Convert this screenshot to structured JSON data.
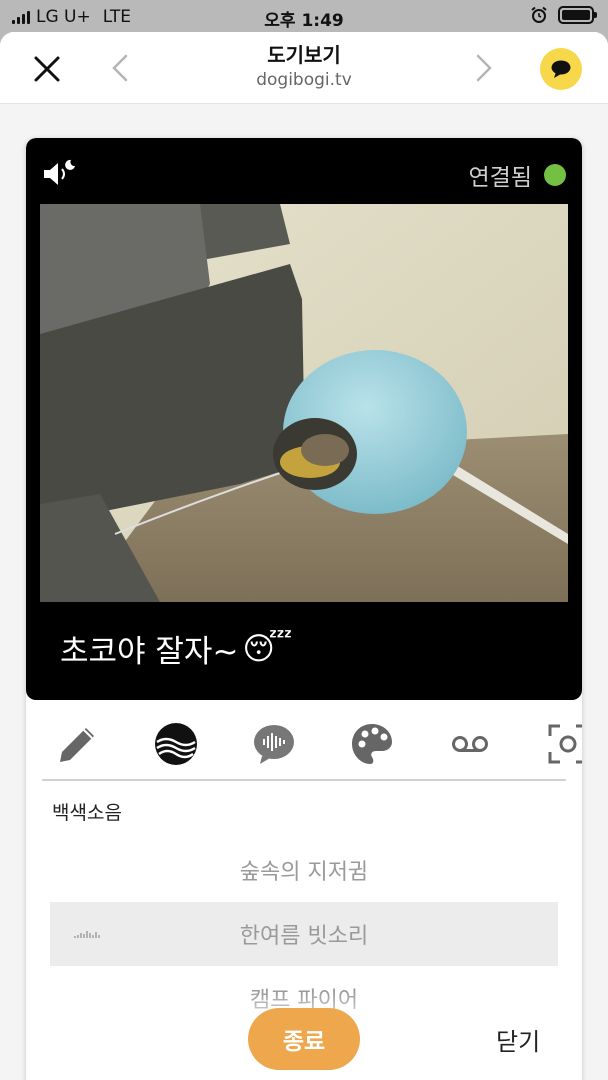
{
  "status_bar": {
    "carrier": "LG U+",
    "network": "LTE",
    "time": "오후 1:49"
  },
  "nav": {
    "title": "도기보기",
    "url": "dogibogi.tv",
    "icons": {
      "close": "close-icon",
      "prev": "chevron-left-icon",
      "next": "chevron-right-icon",
      "chat": "chat-bubble-icon"
    },
    "chat_color": "#f7d84b"
  },
  "player": {
    "status": "연결됨",
    "status_color": "#74c043",
    "caption": "초코야 잘자~",
    "caption_emoji": "😴"
  },
  "tools": [
    {
      "name": "pencil-icon"
    },
    {
      "name": "wave-icon"
    },
    {
      "name": "voice-message-icon"
    },
    {
      "name": "palette-icon"
    },
    {
      "name": "voicemail-icon"
    },
    {
      "name": "camera-capture-icon"
    }
  ],
  "white_noise": {
    "section_title": "백색소음",
    "items": [
      {
        "label": "숲속의 지저귐"
      },
      {
        "label": "한여름 빗소리",
        "selected": true
      },
      {
        "label": "캠프 파이어"
      }
    ]
  },
  "buttons": {
    "stop": "종료",
    "close": "닫기",
    "stop_color": "#eea74c"
  }
}
